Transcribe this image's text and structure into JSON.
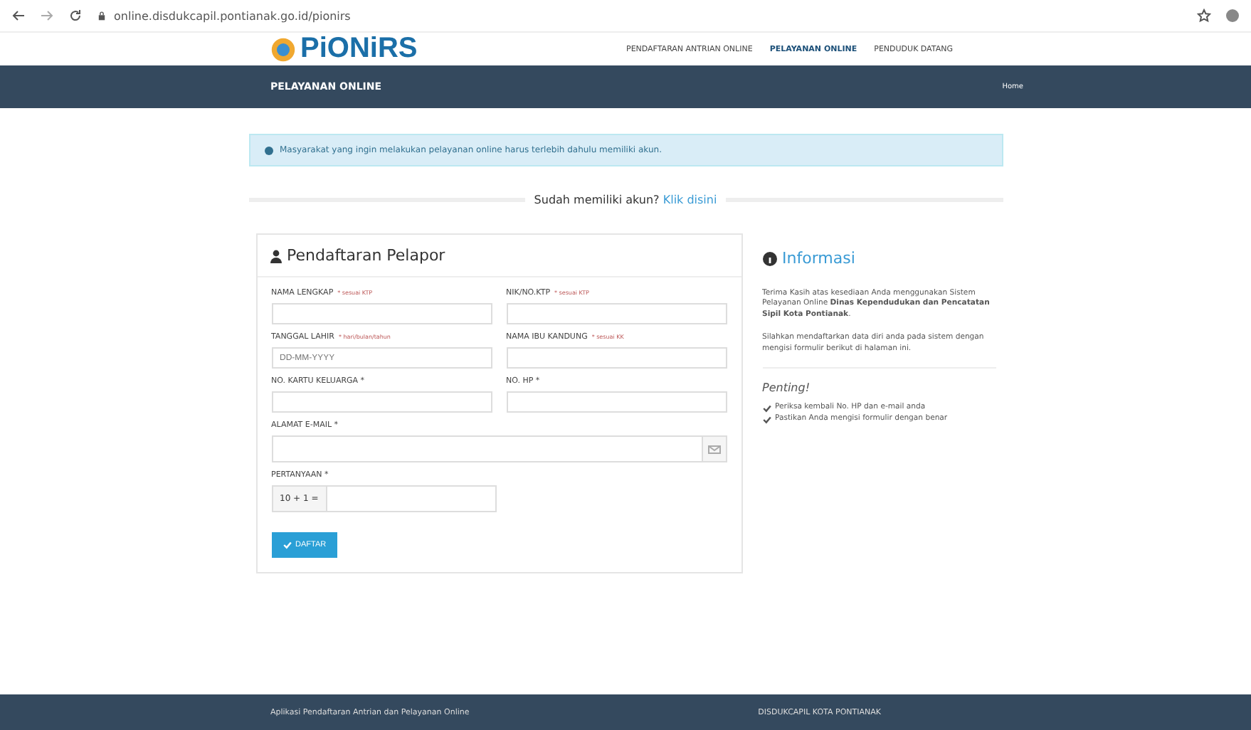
{
  "browser": {
    "url": "online.disdukcapil.pontianak.go.id/pionirs"
  },
  "header": {
    "logo": "PiONiRS",
    "nav": [
      {
        "label": "PENDAFTARAN ANTRIAN ONLINE",
        "selected": false
      },
      {
        "label": "PELAYANAN ONLINE",
        "selected": true
      },
      {
        "label": "PENDUDUK DATANG",
        "selected": false
      }
    ]
  },
  "title_bar": {
    "title": "PELAYANAN ONLINE",
    "breadcrumb": "Home"
  },
  "alert": "Masyarakat yang ingin melakukan pelayanan online harus terlebih dahulu memiliki akun.",
  "login_prompt": {
    "text": "Sudah memiliki akun?",
    "link": "Klik disini"
  },
  "form": {
    "title": "Pendaftaran Pelapor",
    "fields": [
      {
        "label": "NAMA LENGKAP",
        "hint": "* sesuai KTP",
        "kind": "text"
      },
      {
        "label": "NIK/NO.KTP",
        "hint": "* sesuai KTP",
        "kind": "text"
      },
      {
        "label": "TANGGAL LAHIR",
        "hint": "* hari/bulan/tahun",
        "kind": "text",
        "placeholder": "DD-MM-YYYY"
      },
      {
        "label": "NAMA IBU KANDUNG",
        "hint": "* sesuai KK",
        "kind": "text"
      },
      {
        "label": "NO. KARTU KELUARGA *",
        "kind": "text"
      },
      {
        "label": "NO. HP *",
        "kind": "text"
      },
      {
        "label": "ALAMAT E-MAIL *",
        "kind": "email"
      },
      {
        "label": "PERTANYAAN *",
        "kind": "captcha",
        "prefix": "10 + 1 ="
      }
    ],
    "submit": "DAFTAR"
  },
  "info": {
    "title": "Informasi",
    "paragraphs": [
      "Terima Kasih atas kesediaan Anda menggunakan Sistem Pelayanan Online **Dinas Kependudukan dan Pencatatan Sipil Kota Pontianak**.",
      "Silahkan mendaftarkan data diri anda pada sistem dengan mengisi formulir berikut di halaman ini."
    ],
    "important_title": "Penting!",
    "checklist": [
      "Periksa kembali No. HP dan e-mail anda",
      "Pastikan Anda mengisi formulir dengan benar"
    ]
  },
  "footer": {
    "left": "Aplikasi Pendaftaran Antrian dan Pelayanan Online",
    "right": "DISDUKCAPIL KOTA PONTIANAK"
  }
}
